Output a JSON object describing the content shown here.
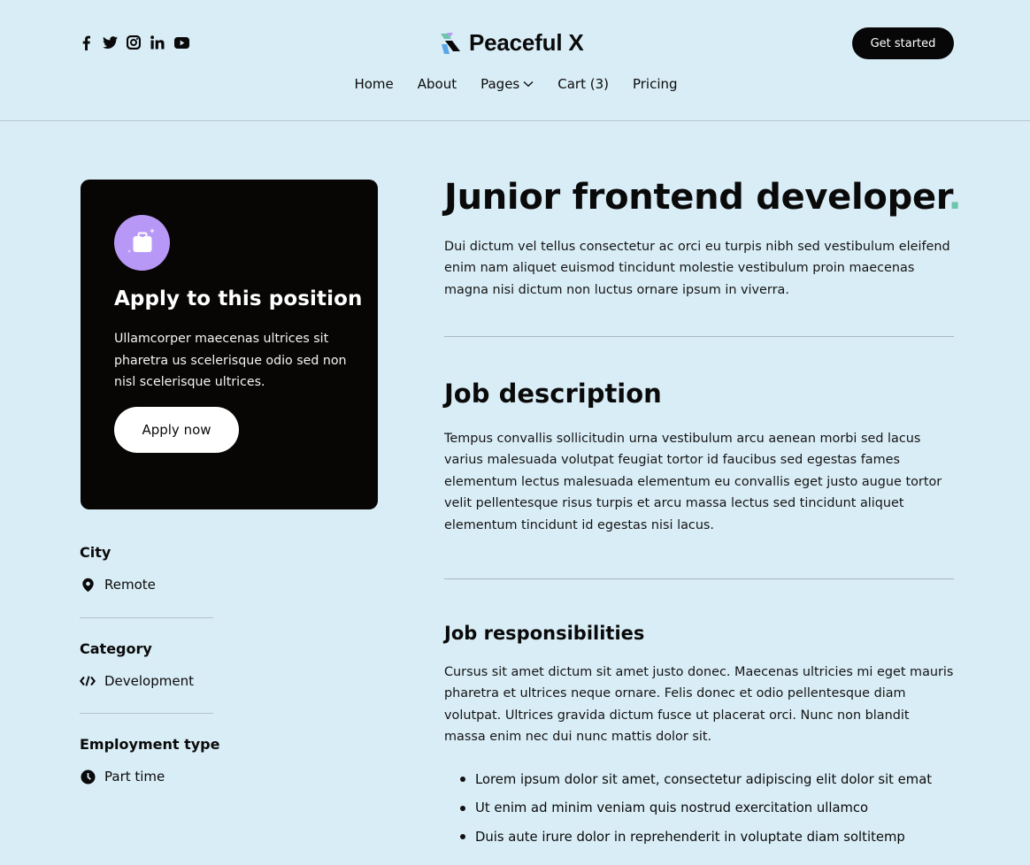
{
  "header": {
    "social": [
      {
        "icon": "facebook-icon"
      },
      {
        "icon": "twitter-icon"
      },
      {
        "icon": "instagram-icon"
      },
      {
        "icon": "linkedin-icon"
      },
      {
        "icon": "youtube-icon"
      }
    ],
    "logo_text": "Peaceful X",
    "cta_label": "Get started",
    "nav": {
      "home": "Home",
      "about": "About",
      "pages": "Pages",
      "cart": "Cart (3)",
      "pricing": "Pricing"
    }
  },
  "apply_card": {
    "title": "Apply to this position",
    "text": "Ullamcorper maecenas ultrices sit pharetra us scelerisque odio sed non nisl scelerisque ultrices.",
    "button_label": "Apply now"
  },
  "details": {
    "city_label": "City",
    "city_value": "Remote",
    "category_label": "Category",
    "category_value": "Development",
    "employment_label": "Employment type",
    "employment_value": "Part time"
  },
  "job": {
    "title": "Junior frontend developer",
    "title_dot": ".",
    "intro": "Dui dictum vel tellus consectetur ac orci eu turpis nibh sed vestibulum eleifend enim nam aliquet euismod tincidunt molestie vestibulum proin maecenas magna nisi dictum non luctus ornare ipsum in viverra.",
    "description_heading": "Job description",
    "description": "Tempus convallis sollicitudin urna vestibulum arcu aenean morbi sed lacus varius malesuada volutpat feugiat tortor id faucibus sed egestas fames elementum lectus malesuada elementum eu convallis eget justo augue tortor velit pellentesque risus turpis et arcu massa lectus sed tincidunt aliquet elementum tincidunt id egestas nisi lacus.",
    "responsibilities_heading": "Job responsibilities",
    "responsibilities_text": "Cursus sit amet dictum sit amet justo donec. Maecenas ultricies mi eget mauris pharetra et ultrices neque ornare. Felis donec et odio pellentesque diam volutpat. Ultrices gravida dictum fusce ut placerat orci. Nunc non blandit massa enim nec dui nunc mattis dolor sit.",
    "bullets": [
      "Lorem ipsum dolor sit amet, consectetur adipiscing elit dolor sit emat",
      "Ut enim ad minim veniam quis nostrud exercitation ullamco",
      "Duis aute irure dolor in reprehenderit in voluptate diam soltitemp"
    ]
  },
  "colors": {
    "background": "#d9edf6",
    "card": "#070605",
    "accent_dot": "#6fc4ad",
    "badge": "#b898f7"
  }
}
